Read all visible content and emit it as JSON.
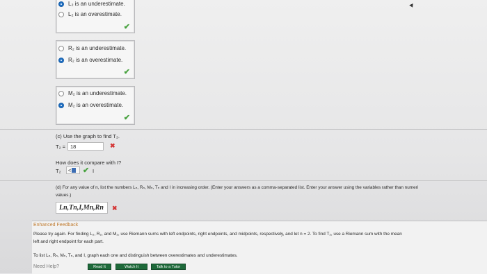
{
  "l2": {
    "option1": "L₂ is an underestimate.",
    "option2": "L₂ is an overestimate."
  },
  "r2": {
    "option1": "R₂ is an underestimate.",
    "option2": "R₂ is an overestimate."
  },
  "m2": {
    "option1": "M₂ is an underestimate.",
    "option2": "M₂ is an overestimate."
  },
  "part_c": {
    "prompt": "(c) Use the graph to find T₂.",
    "t2_label": "T₂ =",
    "t2_value": "18",
    "compare_prompt": "How does it compare with I?",
    "compare_left": "T₂",
    "compare_sign": "<",
    "compare_right": "I"
  },
  "part_d": {
    "prompt": "(d) For any value of n, list the numbers Lₙ, Rₙ, Mₙ, Tₙ and I in increasing order. (Enter your answers as a comma-separated list. Enter your answer using the variables rather than numeri",
    "prompt2": "values.)",
    "answer": "Ln,Tn,I,Mn,Rn"
  },
  "feedback": {
    "title": "Enhanced Feedback",
    "line1": "Please try again. For finding L₂, R₂, and M₂, use Riemann sums with left endpoints, right endpoints, and midpoints, respectively, and let n = 2. To find T₂, use a Riemann sum with the mean",
    "line2": "left and right endpoint for each part.",
    "line3": "To list Lₙ, Rₙ, Mₙ, Tₙ, and I, graph each one and distinguish between overestimates and underestimates.",
    "help": "Need Help?",
    "read_it": "Read It",
    "watch_it": "Watch It",
    "talk_to_tutor": "Talk to a Tutor"
  }
}
